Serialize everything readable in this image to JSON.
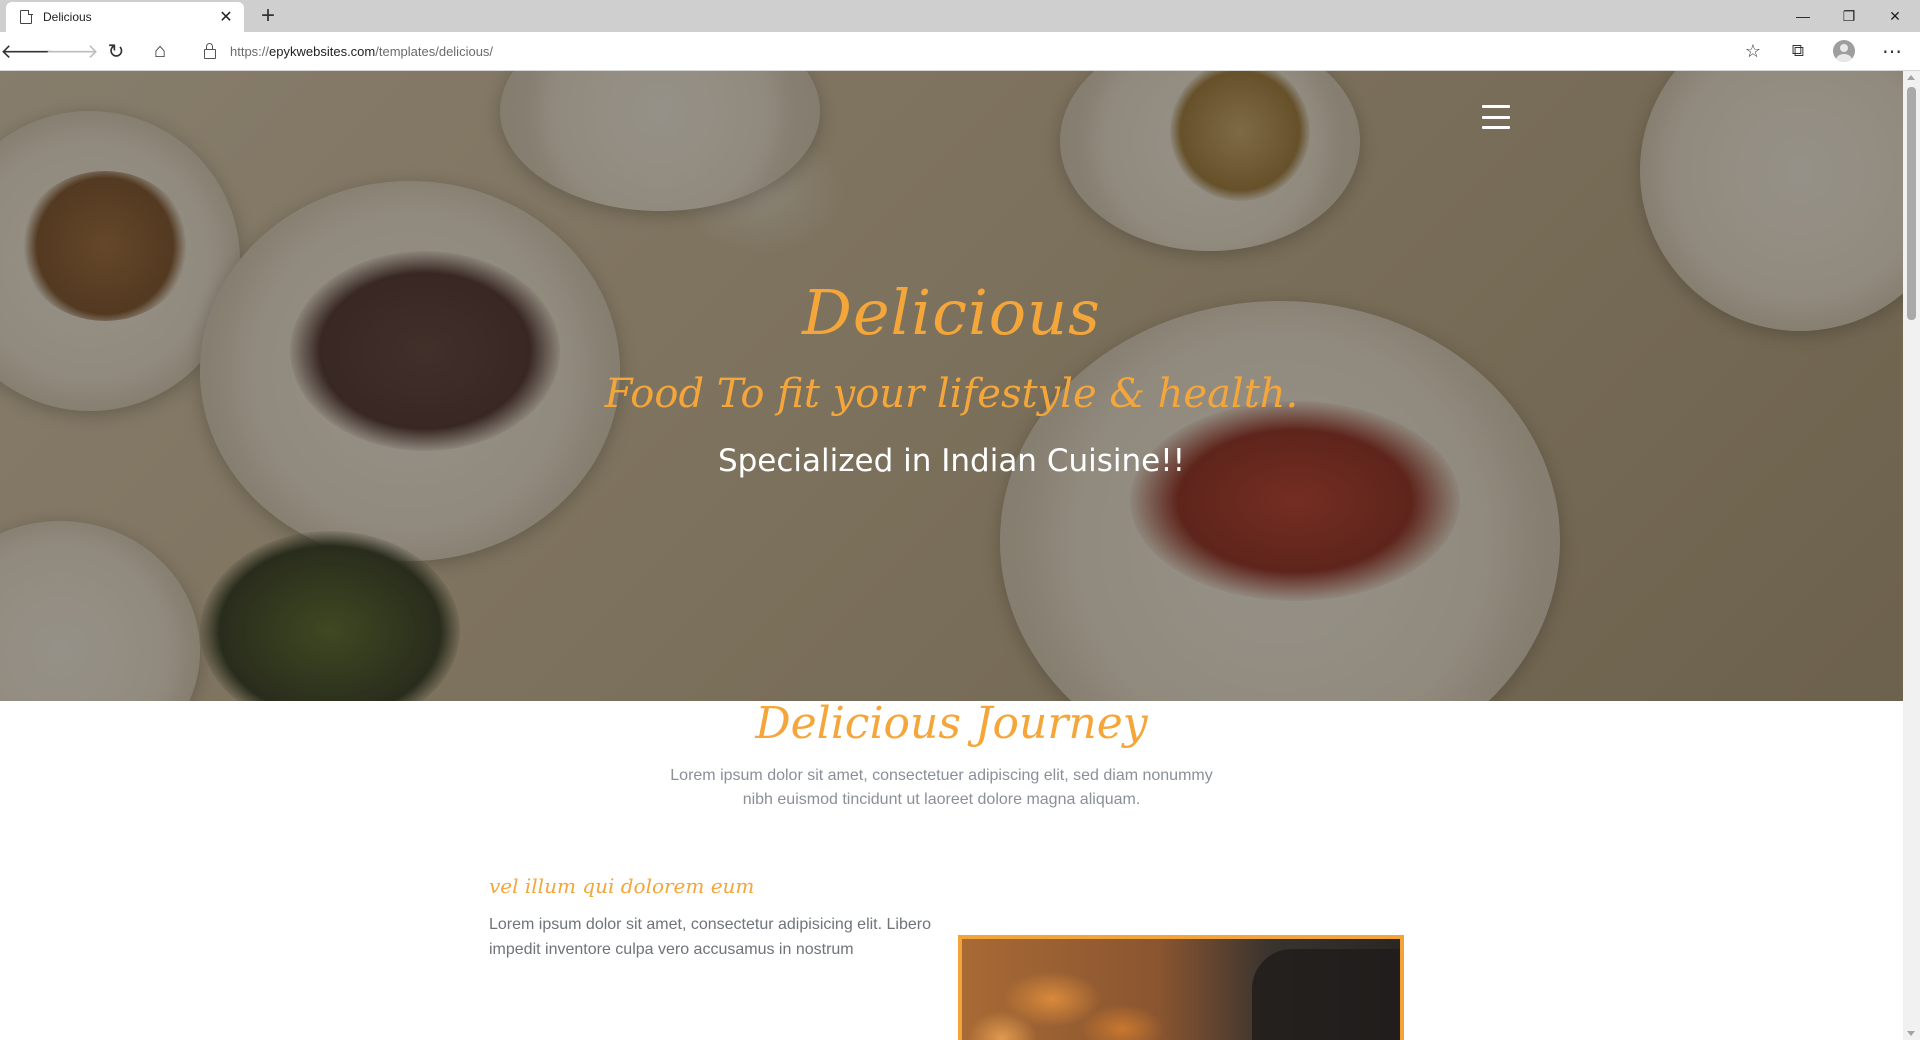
{
  "browser": {
    "tab_title": "Delicious",
    "tab_close": "✕",
    "new_tab": "+",
    "url_prefix": "https://",
    "url_host": "epykwebsites.com",
    "url_path": "/templates/delicious/",
    "window_buttons": {
      "minimize": "—",
      "restore": "❐",
      "close": "✕"
    },
    "toolbar_icons": {
      "back": "🡐",
      "forward": "🡒",
      "reload": "↻",
      "home": "⌂",
      "favorites": "☆",
      "collections": "⧉",
      "more": "⋯"
    }
  },
  "hero": {
    "title": "Delicious",
    "tagline": "Food To fit your lifestyle & health.",
    "subtitle": "Specialized in Indian Cuisine!!"
  },
  "journey": {
    "title": "Delicious Journey",
    "description": "Lorem ipsum dolor sit amet, consectetuer adipiscing elit, sed diam nonummy nibh euismod tincidunt ut laoreet dolore magna aliquam.",
    "feature": {
      "title": "vel illum qui dolorem eum",
      "text": "Lorem ipsum dolor sit amet, consectetur adipisicing elit. Libero impedit inventore culpa vero accusamus in nostrum"
    }
  },
  "colors": {
    "accent": "#f4a63a",
    "muted_text": "#8a8f98"
  }
}
